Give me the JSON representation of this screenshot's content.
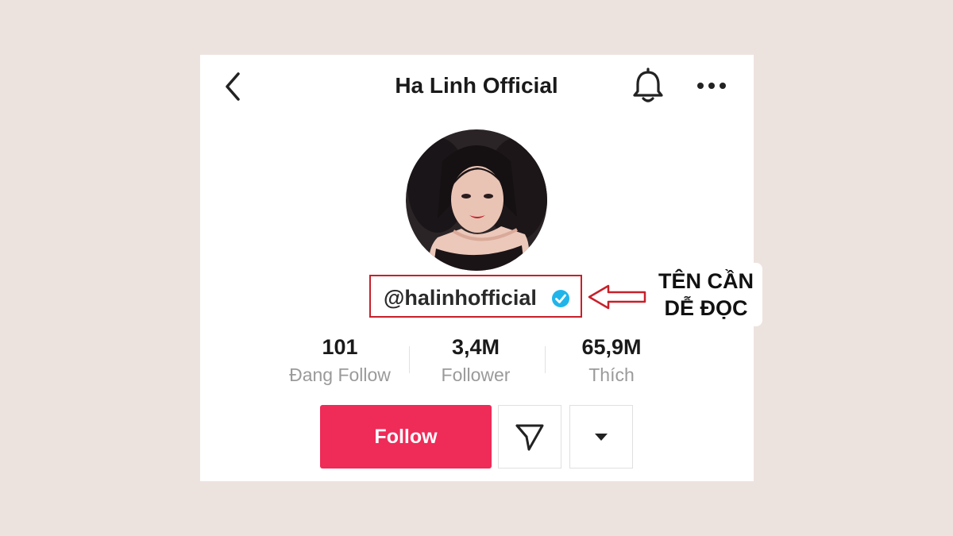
{
  "header": {
    "title": "Ha Linh Official",
    "back_icon": "chevron-left-icon",
    "bell_icon": "bell-icon",
    "more_icon": "more-horizontal-icon"
  },
  "profile": {
    "avatar_icon": "profile-photo",
    "username": "@halinhofficial",
    "verified_icon": "verified-check-icon"
  },
  "annotation": {
    "line1": "TÊN CẦN",
    "line2": "DỄ ĐỌC",
    "highlight_color": "#c8202a"
  },
  "stats": [
    {
      "value": "101",
      "label": "Đang Follow"
    },
    {
      "value": "3,4M",
      "label": "Follower"
    },
    {
      "value": "65,9M",
      "label": "Thích"
    }
  ],
  "actions": {
    "follow_label": "Follow",
    "follow_color": "#ef2b58",
    "message_icon": "send-icon",
    "dropdown_icon": "caret-down-icon"
  },
  "colors": {
    "background": "#ede3de",
    "verified": "#20b5ea"
  }
}
